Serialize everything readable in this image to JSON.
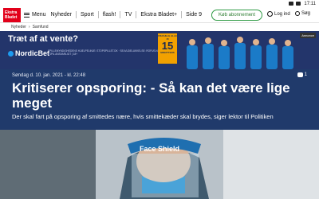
{
  "status_bar": {
    "time": "17:11"
  },
  "logo": {
    "line1": "Ekstra",
    "line2": "Bladet"
  },
  "nav": {
    "menu_label": "Menu",
    "items": [
      "Nyheder",
      "Sport",
      "flash!",
      "TV",
      "Ekstra Bladet+",
      "Side 9"
    ],
    "subscribe_label": "Køb abonnement",
    "login_label": "Log ind",
    "search_label": "Søg"
  },
  "breadcrumb": {
    "items": [
      "Nyheder",
      "Samfund"
    ]
  },
  "ad": {
    "headline": "Træt af at vente?",
    "brand": "NordicBet",
    "fine_print": "SPILLEMYNDIGHEDENS HJÆLPELINJE: STOPSPILLET.DK · SELVUDELUKKELSE: ROFUS.NU | SPIL ANSVARLIGT | 18+",
    "badge_top": "FRAVÆLG ALLE 15",
    "badge_number": "15",
    "badge_bottom": "MINUTTERS",
    "label": "Annonce"
  },
  "article": {
    "dateline": "Søndag d. 10. jan. 2021 - kl. 22:48",
    "comment_count": "1",
    "title": "Kritiserer opsporing: - Så kan det være lige meget",
    "subtitle": "Der skal fart på opsporing af smittedes nære, hvis smittekæder skal brydes, siger lektor til Politiken"
  },
  "photo": {
    "shield_text": "Face Shield"
  },
  "colors": {
    "header_blue": "#203a6b",
    "ad_blue": "#23356b",
    "brand_red": "#e2001a",
    "subscribe_green": "#2e9a44",
    "badge_orange": "#f2a100"
  }
}
